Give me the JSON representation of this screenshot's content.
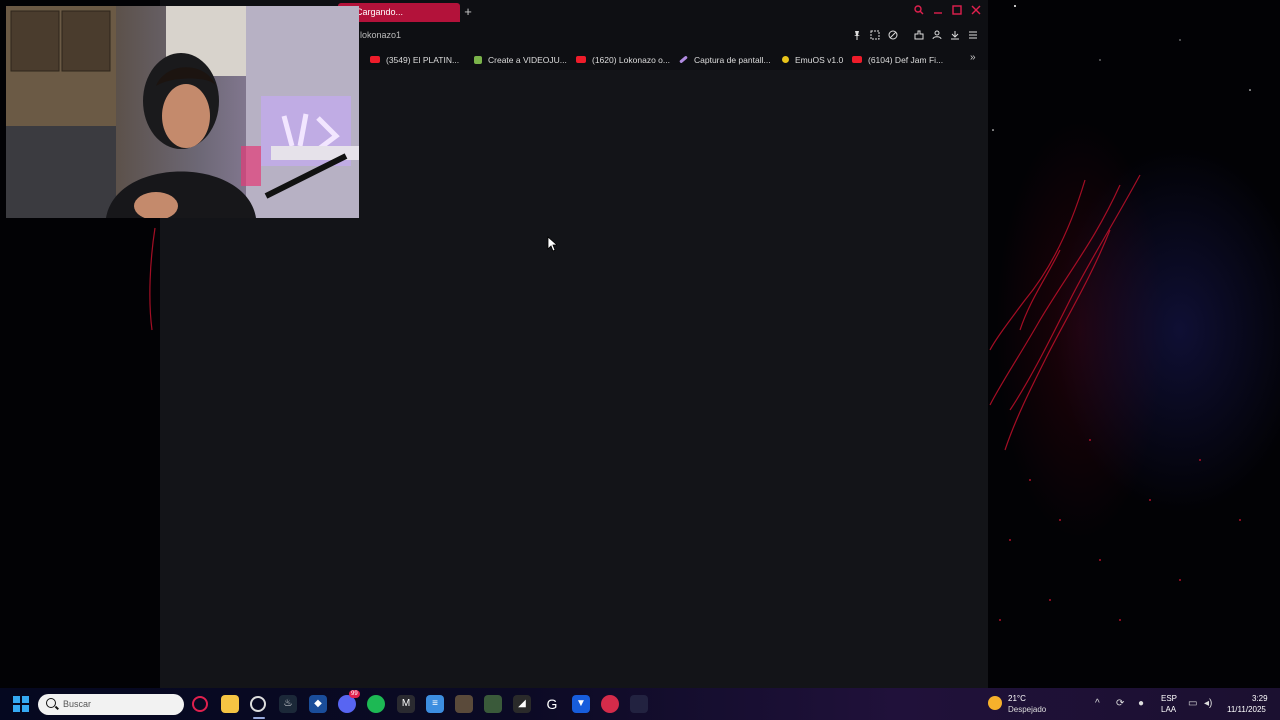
{
  "browser": {
    "tab_title": "Cargando...",
    "new_tab_symbol": "+",
    "address": "lokonazo1",
    "accent": "#e0204e",
    "bookmarks": [
      {
        "label": "(3549) El PLATIN...",
        "icon": "youtube-icon"
      },
      {
        "label": "Create a VIDEOJU...",
        "icon": "page-icon"
      },
      {
        "label": "(1620) Lokonazo o...",
        "icon": "youtube-icon"
      },
      {
        "label": "Captura de pantall...",
        "icon": "feather-icon"
      },
      {
        "label": "EmuOS v1.0",
        "icon": "emuos-icon"
      },
      {
        "label": "(6104) Def Jam Fi...",
        "icon": "youtube-icon"
      }
    ],
    "more_symbol": "»"
  },
  "taskbar": {
    "search_placeholder": "Buscar",
    "apps": [
      "opera-gx-icon",
      "file-explorer-icon",
      "opera-gx-active-icon",
      "steam-icon",
      "app-shield-icon",
      "discord-icon",
      "spotify-icon",
      "app-m-icon",
      "notepad-icon",
      "game-icon",
      "game-icon-2",
      "car-icon",
      "logitech-icon",
      "bitwarden-icon",
      "app-red-icon",
      "app-dark-icon"
    ],
    "discord_badge": "99",
    "weather": {
      "temp": "21°C",
      "desc": "Despejado"
    },
    "language": {
      "line1": "ESP",
      "line2": "LAA"
    },
    "clock": {
      "time": "3:29",
      "date": "11/11/2025"
    }
  }
}
